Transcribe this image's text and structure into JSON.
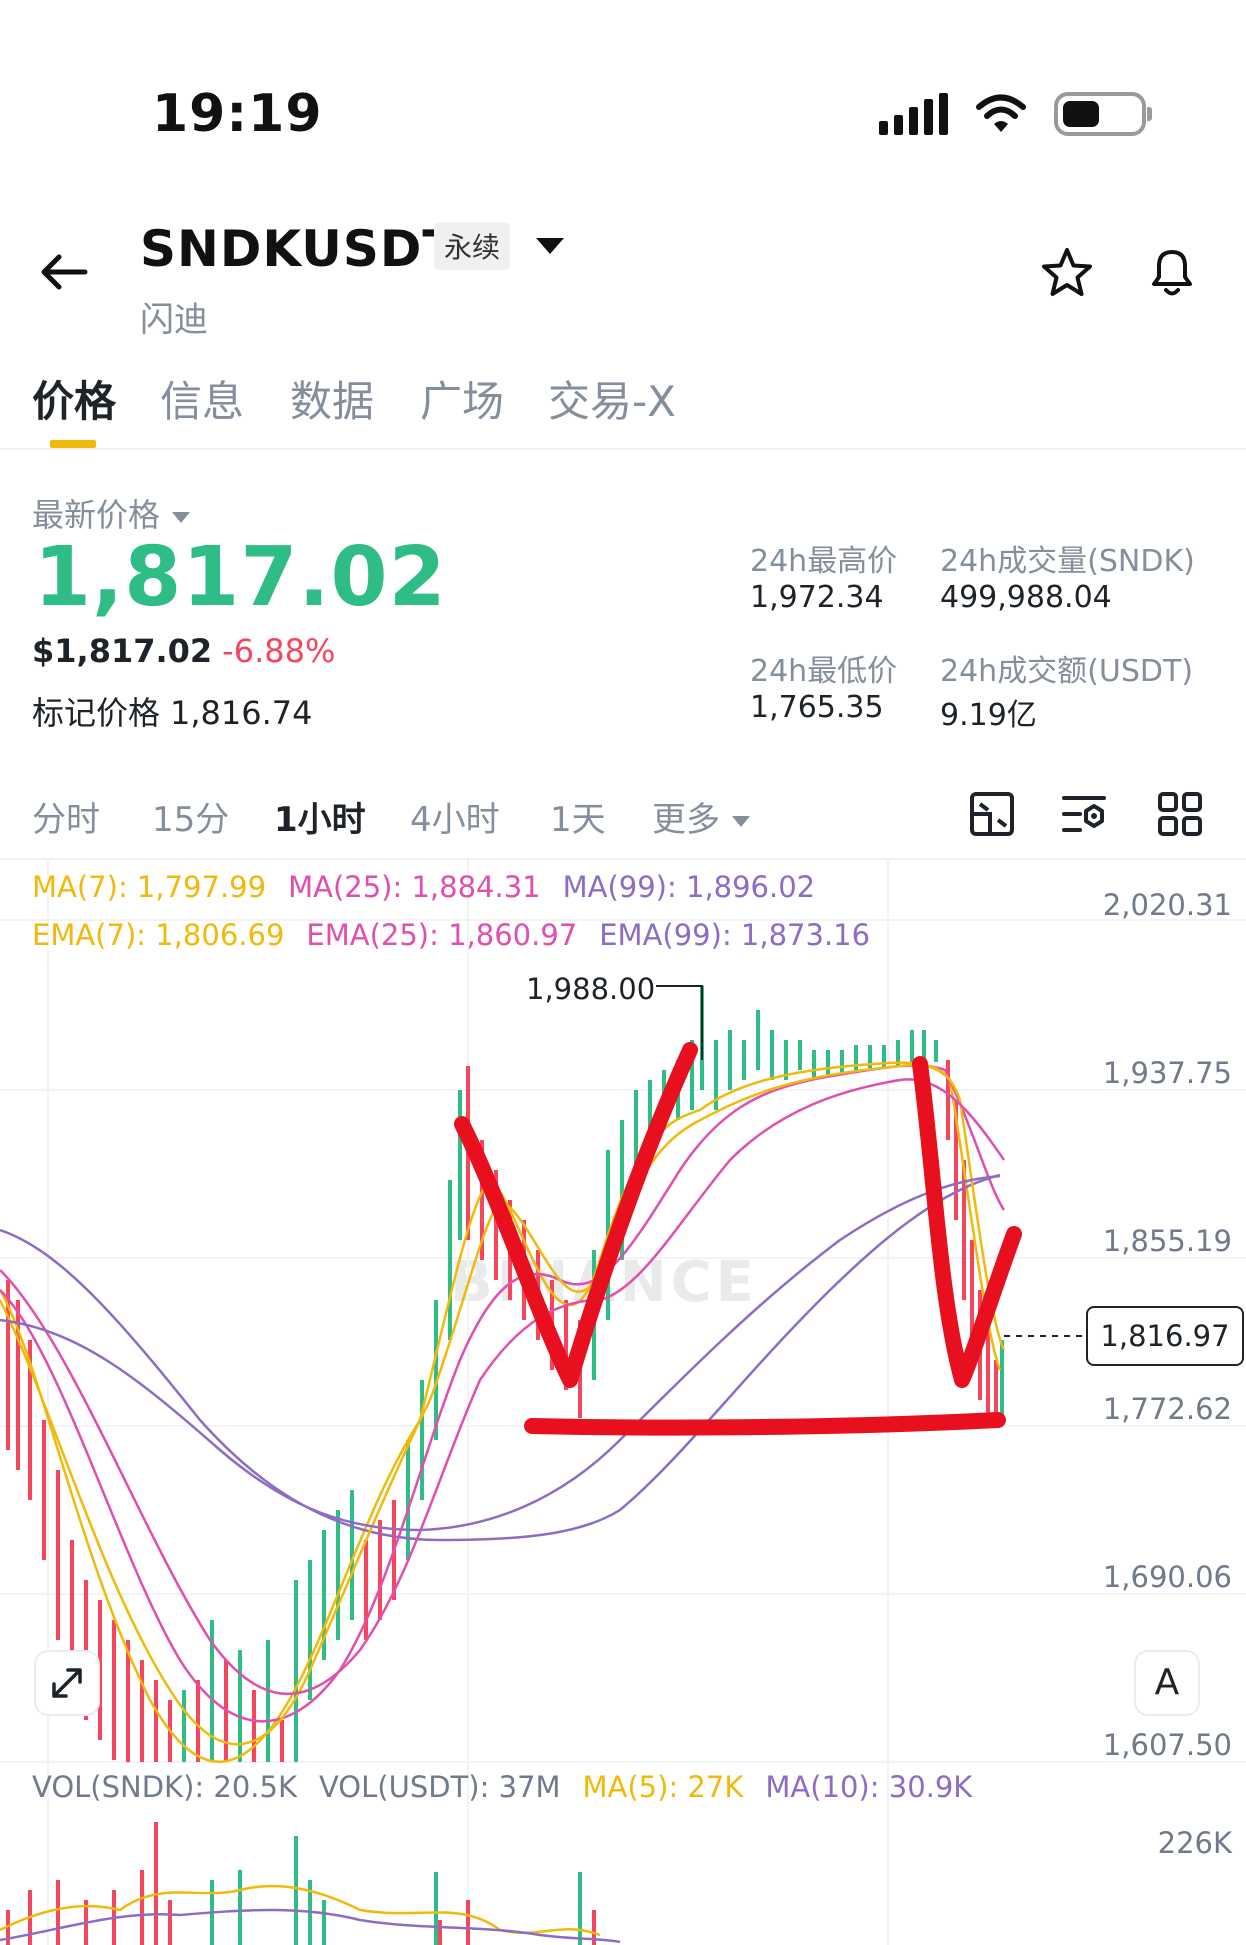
{
  "status_bar": {
    "time": "19:19"
  },
  "header": {
    "symbol": "SNDKUSDT",
    "contract_type": "永续",
    "subtitle": "闪迪"
  },
  "tabs": [
    {
      "label": "价格",
      "active": true
    },
    {
      "label": "信息",
      "active": false
    },
    {
      "label": "数据",
      "active": false
    },
    {
      "label": "广场",
      "active": false
    },
    {
      "label": "交易-X",
      "active": false
    }
  ],
  "price": {
    "label": "最新价格",
    "last": "1,817.02",
    "usd": "$1,817.02",
    "change": "-6.88%",
    "mark_label": "标记价格",
    "mark_value": "1,816.74"
  },
  "stats": {
    "high_label": "24h最高价",
    "high_value": "1,972.34",
    "vol_label": "24h成交量(SNDK)",
    "vol_value": "499,988.04",
    "low_label": "24h最低价",
    "low_value": "1,765.35",
    "turnover_label": "24h成交额(USDT)",
    "turnover_value": "9.19亿"
  },
  "intervals": [
    {
      "label": "分时",
      "active": false
    },
    {
      "label": "15分",
      "active": false
    },
    {
      "label": "1小时",
      "active": true
    },
    {
      "label": "4小时",
      "active": false
    },
    {
      "label": "1天",
      "active": false
    },
    {
      "label": "更多",
      "active": false
    }
  ],
  "indicators": {
    "ma7": "MA(7): 1,797.99",
    "ma25": "MA(25): 1,884.31",
    "ma99": "MA(99): 1,896.02",
    "ema7": "EMA(7): 1,806.69",
    "ema25": "EMA(25): 1,860.97",
    "ema99": "EMA(99): 1,873.16"
  },
  "chart": {
    "y_labels": [
      "2,020.31",
      "1,937.75",
      "1,855.19",
      "1,772.62",
      "1,690.06",
      "1,607.50"
    ],
    "current_price_tag": "1,816.97",
    "high_marker": "1,988.00",
    "watermark": "BINANCE",
    "auto_label": "A"
  },
  "volume": {
    "vol_sndk": "VOL(SNDK): 20.5K",
    "vol_usdt": "VOL(USDT): 37M",
    "ma5": "MA(5): 27K",
    "ma10": "MA(10): 30.9K",
    "y_max": "226K"
  },
  "colors": {
    "up": "#2ebd85",
    "down": "#f6465d",
    "accent": "#f0b90b",
    "ma7": "#f0b90b",
    "ma25": "#e04fae",
    "ma99": "#8e6cc4",
    "annotation": "#e8101e"
  }
}
